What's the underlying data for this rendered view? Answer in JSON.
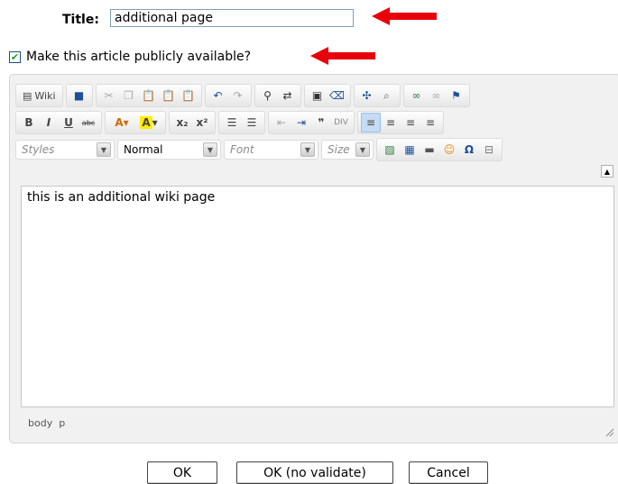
{
  "form": {
    "title_label": "Title:",
    "title_value": "additional page",
    "public_label": "Make this article publicly available?",
    "public_checked": true
  },
  "toolbar": {
    "wiki_label": "Wiki",
    "styles_label": "Styles",
    "format_value": "Normal",
    "font_label": "Font",
    "size_label": "Size"
  },
  "editor": {
    "content": "this is an additional wiki page",
    "path": "body  p"
  },
  "buttons": {
    "ok": "OK",
    "ok_no_validate": "OK (no validate)",
    "cancel": "Cancel"
  },
  "colors": {
    "arrow": "#e8000b",
    "check": "#21a121",
    "active_button": "#c6dcf5"
  }
}
